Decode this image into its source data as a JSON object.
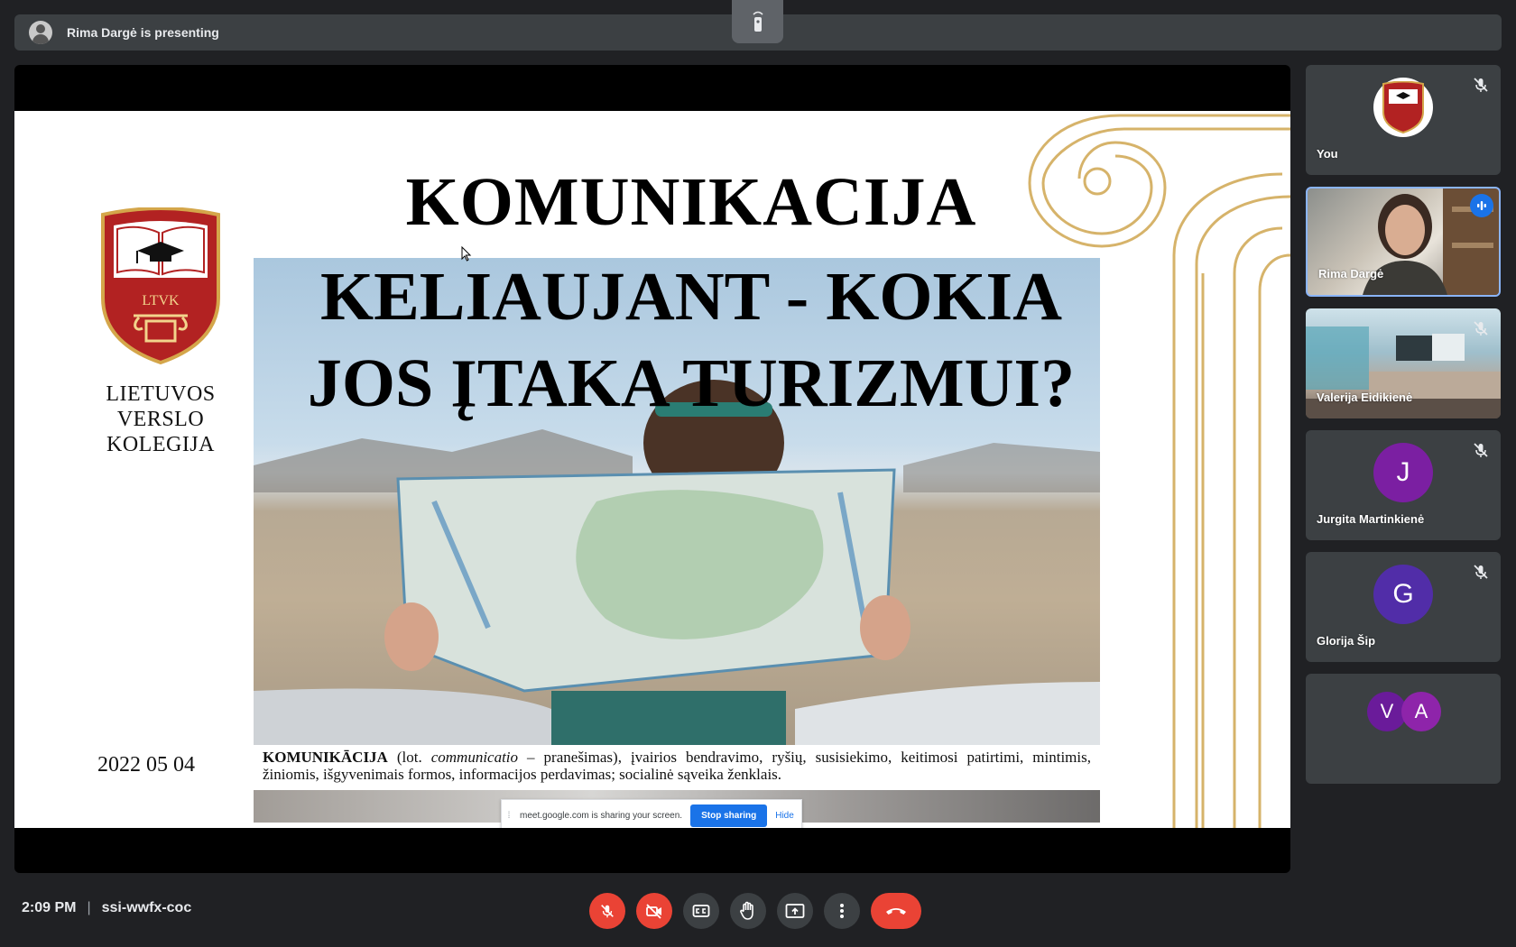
{
  "presenting_bar": {
    "text": "Rima Dargė is presenting"
  },
  "slide": {
    "logo_text": "LTVK",
    "college_lines": [
      "LIETUVOS",
      "VERSLO",
      "KOLEGIJA"
    ],
    "title_line1": "KOMUNIKACIJA",
    "title_line2": "KELIAUJANT - KOKIA",
    "title_line3": "JOS ĮTAKA TURIZMUI?",
    "date": "2022 05 04",
    "definition_term": "KOMUNIKĀCIJA",
    "definition_lot": " (lot. ",
    "definition_latin": "communicatio",
    "definition_rest": " – pranešimas), įvairios bendravimo, ryšių, susisiekimo, keitimosi patirtimi, mintimis, žiniomis, išgyvenimais formos, informacijos perdavimas; socialinė sąveika ženklais."
  },
  "share_bar": {
    "text": "meet.google.com is sharing your screen.",
    "stop_label": "Stop sharing",
    "hide_label": "Hide"
  },
  "participants": [
    {
      "name": "You",
      "type": "logo",
      "muted": true
    },
    {
      "name": "Rima Dargė",
      "type": "video",
      "speaking": true
    },
    {
      "name": "Valerija Eidikienė",
      "type": "video",
      "muted": true
    },
    {
      "name": "Jurgita Martinkienė",
      "initial": "J",
      "color": "#7b1fa2",
      "muted": true
    },
    {
      "name": "Glorija Šip",
      "initial": "G",
      "color": "#512da8",
      "muted": true
    },
    {
      "name": "",
      "initials": [
        "V",
        "A"
      ],
      "colors": [
        "#6a1b9a",
        "#8e24aa"
      ]
    }
  ],
  "bottom_bar": {
    "time": "2:09 PM",
    "meeting_code": "ssi-wwfx-coc"
  },
  "colors": {
    "background": "#202124",
    "red": "#ea4335",
    "blue": "#1a73e8",
    "tile": "#3c4043"
  }
}
